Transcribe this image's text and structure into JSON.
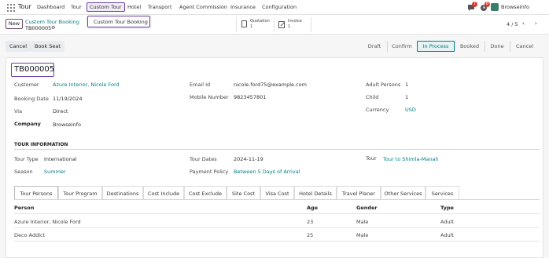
{
  "navbar": {
    "app_name": "Tour",
    "menu": [
      "Dashboard",
      "Tour",
      "Custom Tour",
      "Hotel",
      "Transport",
      "Agent Commission",
      "Insurance",
      "Configuration"
    ],
    "active_menu": "Custom Tour",
    "badge_messages": "7",
    "badge_activities": "8",
    "company": "BrowseInfo"
  },
  "dropdown": {
    "item": "Custom Tour Booking"
  },
  "control": {
    "new_label": "New",
    "breadcrumb_parent": "Custom Tour Booking",
    "breadcrumb_current": "TB000005",
    "quotation_label": "Quotation",
    "quotation_count": "1",
    "invoice_label": "Invoice",
    "invoice_count": "1",
    "pager": "4 / 5"
  },
  "statusbar": {
    "cancel_label": "Cancel",
    "book_seat_label": "Book Seat",
    "stages": [
      "Draft",
      "Confirm",
      "In Process",
      "Booked",
      "Done",
      "Cancel"
    ],
    "current_stage": "In Process"
  },
  "form": {
    "reference": "TB000005",
    "customer_label": "Customer",
    "customer": "Azure Interior, Nicole Ford",
    "booking_date_label": "Booking Date",
    "booking_date": "11/19/2024",
    "via_label": "Via",
    "via": "Direct",
    "company_label": "Company",
    "company": "BrowseInfo",
    "email_label": "Email Id",
    "email": "nicole.ford75@example.com",
    "mobile_label": "Mobile Number",
    "mobile": "9823457801",
    "adult_label": "Adult Persons",
    "adult": "1",
    "child_label": "Child",
    "child": "1",
    "currency_label": "Currency",
    "currency": "USD",
    "section_title": "TOUR INFORMATION",
    "tour_type_label": "Tour Type",
    "tour_type": "International",
    "season_label": "Season",
    "season": "Summer",
    "tour_dates_label": "Tour Dates",
    "tour_dates": "2024-11-19",
    "payment_policy_label": "Payment Policy",
    "payment_policy": "Between 5 Days of Arrival",
    "tour_label": "Tour",
    "tour": "Tour to Shimla-Manali"
  },
  "tabs": [
    "Tour Persons",
    "Tour Program",
    "Destinations",
    "Cost Include",
    "Cost Exclude",
    "Site Cost",
    "Visa Cost",
    "Hotel Details",
    "Travel Planer",
    "Other Services",
    "Services"
  ],
  "active_tab": "Tour Persons",
  "table": {
    "headers": [
      "Person",
      "Age",
      "Gender",
      "Type"
    ],
    "rows": [
      [
        "Azure Interior, Nicole Ford",
        "23",
        "Male",
        "Adult"
      ],
      [
        "Deco Addict",
        "25",
        "Male",
        "Adult"
      ]
    ]
  },
  "colors": {
    "accent": "#017e84",
    "brand": "#714b67",
    "highlight": "#6b3ea8"
  }
}
